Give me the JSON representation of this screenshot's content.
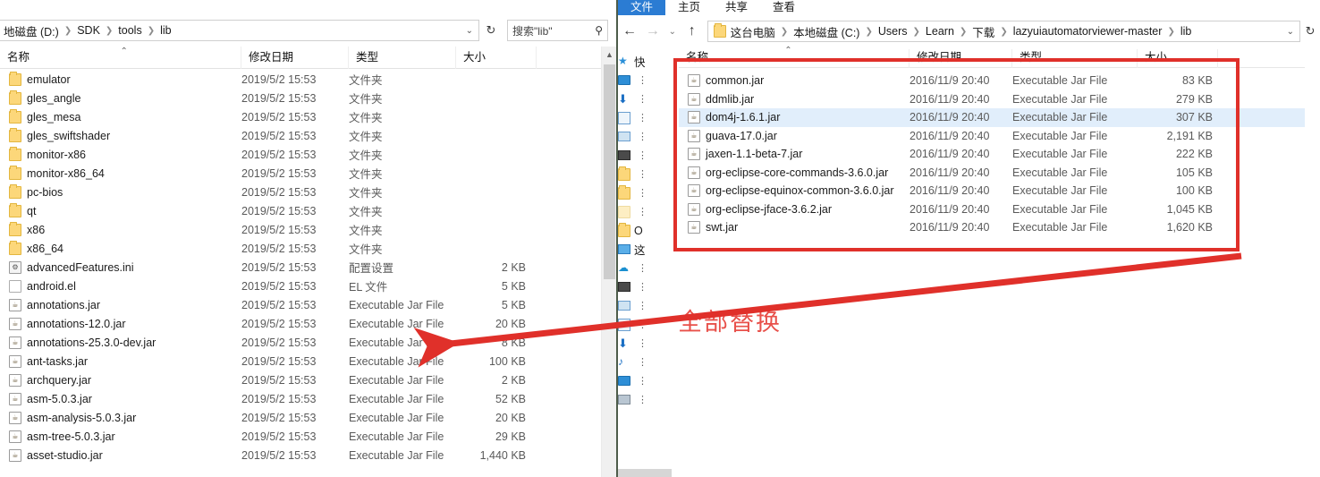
{
  "left_window": {
    "address": {
      "crumbs": [
        "地磁盘 (D:)",
        "SDK",
        "tools",
        "lib"
      ],
      "dropdown_icon": "chevron-down-icon",
      "refresh_icon": "↻"
    },
    "search": {
      "placeholder": "搜索\"lib\"",
      "icon": "search-icon"
    },
    "columns": [
      {
        "key": "name",
        "label": "名称",
        "sorted": true
      },
      {
        "key": "date",
        "label": "修改日期",
        "sorted": false
      },
      {
        "key": "type",
        "label": "类型",
        "sorted": false
      },
      {
        "key": "size",
        "label": "大小",
        "sorted": false
      }
    ],
    "rows": [
      {
        "icon": "folder",
        "name": "emulator",
        "date": "2019/5/2 15:53",
        "type": "文件夹",
        "size": ""
      },
      {
        "icon": "folder",
        "name": "gles_angle",
        "date": "2019/5/2 15:53",
        "type": "文件夹",
        "size": ""
      },
      {
        "icon": "folder",
        "name": "gles_mesa",
        "date": "2019/5/2 15:53",
        "type": "文件夹",
        "size": ""
      },
      {
        "icon": "folder",
        "name": "gles_swiftshader",
        "date": "2019/5/2 15:53",
        "type": "文件夹",
        "size": ""
      },
      {
        "icon": "folder",
        "name": "monitor-x86",
        "date": "2019/5/2 15:53",
        "type": "文件夹",
        "size": ""
      },
      {
        "icon": "folder",
        "name": "monitor-x86_64",
        "date": "2019/5/2 15:53",
        "type": "文件夹",
        "size": ""
      },
      {
        "icon": "folder",
        "name": "pc-bios",
        "date": "2019/5/2 15:53",
        "type": "文件夹",
        "size": ""
      },
      {
        "icon": "folder",
        "name": "qt",
        "date": "2019/5/2 15:53",
        "type": "文件夹",
        "size": ""
      },
      {
        "icon": "folder",
        "name": "x86",
        "date": "2019/5/2 15:53",
        "type": "文件夹",
        "size": ""
      },
      {
        "icon": "folder",
        "name": "x86_64",
        "date": "2019/5/2 15:53",
        "type": "文件夹",
        "size": ""
      },
      {
        "icon": "ini",
        "name": "advancedFeatures.ini",
        "date": "2019/5/2 15:53",
        "type": "配置设置",
        "size": "2 KB"
      },
      {
        "icon": "doc",
        "name": "android.el",
        "date": "2019/5/2 15:53",
        "type": "EL 文件",
        "size": "5 KB"
      },
      {
        "icon": "jar",
        "name": "annotations.jar",
        "date": "2019/5/2 15:53",
        "type": "Executable Jar File",
        "size": "5 KB"
      },
      {
        "icon": "jar",
        "name": "annotations-12.0.jar",
        "date": "2019/5/2 15:53",
        "type": "Executable Jar File",
        "size": "20 KB"
      },
      {
        "icon": "jar",
        "name": "annotations-25.3.0-dev.jar",
        "date": "2019/5/2 15:53",
        "type": "Executable Jar File",
        "size": "8 KB"
      },
      {
        "icon": "jar",
        "name": "ant-tasks.jar",
        "date": "2019/5/2 15:53",
        "type": "Executable Jar File",
        "size": "100 KB"
      },
      {
        "icon": "jar",
        "name": "archquery.jar",
        "date": "2019/5/2 15:53",
        "type": "Executable Jar File",
        "size": "2 KB"
      },
      {
        "icon": "jar",
        "name": "asm-5.0.3.jar",
        "date": "2019/5/2 15:53",
        "type": "Executable Jar File",
        "size": "52 KB"
      },
      {
        "icon": "jar",
        "name": "asm-analysis-5.0.3.jar",
        "date": "2019/5/2 15:53",
        "type": "Executable Jar File",
        "size": "20 KB"
      },
      {
        "icon": "jar",
        "name": "asm-tree-5.0.3.jar",
        "date": "2019/5/2 15:53",
        "type": "Executable Jar File",
        "size": "29 KB"
      },
      {
        "icon": "jar",
        "name": "asset-studio.jar",
        "date": "2019/5/2 15:53",
        "type": "Executable Jar File",
        "size": "1,440 KB"
      }
    ]
  },
  "right_window": {
    "ribbon_tabs": [
      {
        "label": "文件",
        "active": true
      },
      {
        "label": "主页",
        "active": false
      },
      {
        "label": "共享",
        "active": false
      },
      {
        "label": "查看",
        "active": false
      }
    ],
    "help_icon": "?",
    "nav": {
      "back_icon": "←",
      "forward_icon": "→",
      "recent_icon": "⌄",
      "up_icon": "↑",
      "refresh_icon": "↻",
      "dropdown_icon": "⌄"
    },
    "address": {
      "crumbs": [
        "这台电脑",
        "本地磁盘 (C:)",
        "Users",
        "Learn",
        "下载",
        "lazyuiautomatorviewer-master",
        "lib"
      ]
    },
    "columns": [
      {
        "key": "name",
        "label": "名称",
        "sorted": true
      },
      {
        "key": "date",
        "label": "修改日期",
        "sorted": false
      },
      {
        "key": "type",
        "label": "类型",
        "sorted": false
      },
      {
        "key": "size",
        "label": "大小",
        "sorted": false
      }
    ],
    "rows": [
      {
        "icon": "jar",
        "name": "common.jar",
        "date": "2016/11/9 20:40",
        "type": "Executable Jar File",
        "size": "83 KB",
        "selected": false
      },
      {
        "icon": "jar",
        "name": "ddmlib.jar",
        "date": "2016/11/9 20:40",
        "type": "Executable Jar File",
        "size": "279 KB",
        "selected": false
      },
      {
        "icon": "jar",
        "name": "dom4j-1.6.1.jar",
        "date": "2016/11/9 20:40",
        "type": "Executable Jar File",
        "size": "307 KB",
        "selected": true
      },
      {
        "icon": "jar",
        "name": "guava-17.0.jar",
        "date": "2016/11/9 20:40",
        "type": "Executable Jar File",
        "size": "2,191 KB",
        "selected": false
      },
      {
        "icon": "jar",
        "name": "jaxen-1.1-beta-7.jar",
        "date": "2016/11/9 20:40",
        "type": "Executable Jar File",
        "size": "222 KB",
        "selected": false
      },
      {
        "icon": "jar",
        "name": "org-eclipse-core-commands-3.6.0.jar",
        "date": "2016/11/9 20:40",
        "type": "Executable Jar File",
        "size": "105 KB",
        "selected": false
      },
      {
        "icon": "jar",
        "name": "org-eclipse-equinox-common-3.6.0.jar",
        "date": "2016/11/9 20:40",
        "type": "Executable Jar File",
        "size": "100 KB",
        "selected": false
      },
      {
        "icon": "jar",
        "name": "org-eclipse-jface-3.6.2.jar",
        "date": "2016/11/9 20:40",
        "type": "Executable Jar File",
        "size": "1,045 KB",
        "selected": false
      },
      {
        "icon": "jar",
        "name": "swt.jar",
        "date": "2016/11/9 20:40",
        "type": "Executable Jar File",
        "size": "1,620 KB",
        "selected": false
      }
    ],
    "sidebar": [
      {
        "icon": "star",
        "label": "快"
      },
      {
        "icon": "monitor",
        "label": ""
      },
      {
        "icon": "download",
        "label": ""
      },
      {
        "icon": "docs",
        "label": ""
      },
      {
        "icon": "pic",
        "label": ""
      },
      {
        "icon": "video",
        "label": ""
      },
      {
        "icon": "folder",
        "label": ""
      },
      {
        "icon": "folder",
        "label": ""
      },
      {
        "icon": "folderpale",
        "label": ""
      },
      {
        "icon": "folder",
        "label": "O"
      },
      {
        "icon": "pc",
        "label": "这"
      },
      {
        "icon": "onedrive",
        "label": ""
      },
      {
        "icon": "video",
        "label": ""
      },
      {
        "icon": "pic",
        "label": ""
      },
      {
        "icon": "docs",
        "label": ""
      },
      {
        "icon": "download",
        "label": ""
      },
      {
        "icon": "music",
        "label": ""
      },
      {
        "icon": "monitor",
        "label": ""
      },
      {
        "icon": "hdd",
        "label": ""
      }
    ]
  },
  "annotations": {
    "callout_text": "全部替换",
    "callout_color": "#e8504a",
    "box_color": "#e0302a",
    "arrow_color": "#e0302a"
  }
}
